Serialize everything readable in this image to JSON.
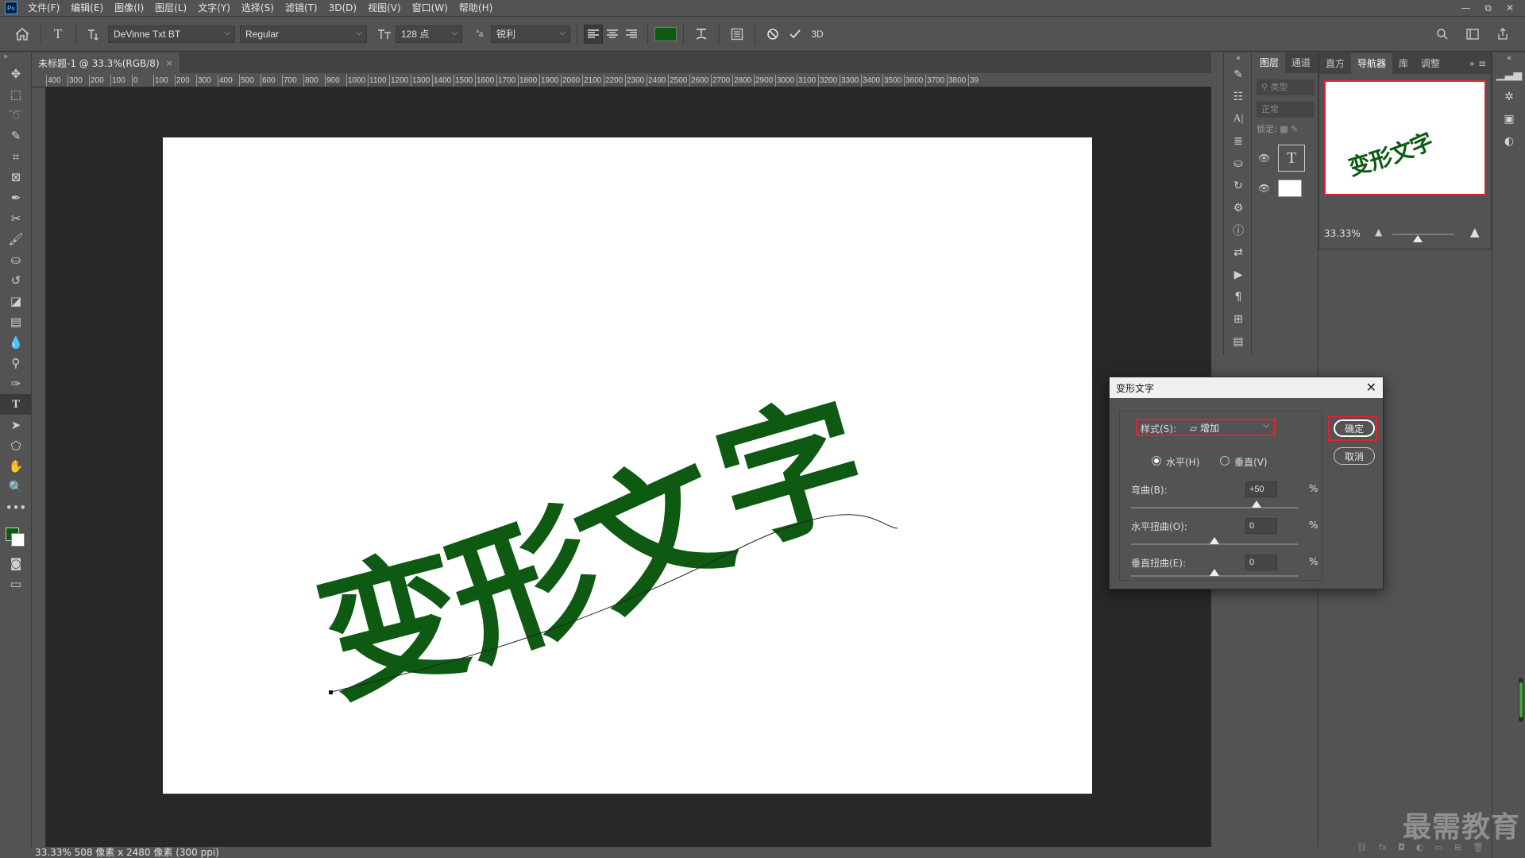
{
  "menubar": {
    "logo": "Ps",
    "items": [
      "文件(F)",
      "编辑(E)",
      "图像(I)",
      "图层(L)",
      "文字(Y)",
      "选择(S)",
      "滤镜(T)",
      "3D(D)",
      "视图(V)",
      "窗口(W)",
      "帮助(H)"
    ],
    "window_controls": [
      "—",
      "⧉",
      "✕"
    ]
  },
  "options": {
    "font_family": "DeVinne Txt BT",
    "font_style": "Regular",
    "font_size": "128 点",
    "antialias_icon_label": "ªa",
    "antialias": "锐利",
    "text_color": "#0e5a12",
    "three_d_label": "3D"
  },
  "document": {
    "tab_title": "未标题-1 @ 33.3%(RGB/8)",
    "tab_close": "×",
    "text": "变形文字",
    "text_color": "#0e5a12"
  },
  "ruler": {
    "h_labels": [
      "400",
      "300",
      "200",
      "100",
      "0",
      "100",
      "200",
      "300",
      "400",
      "500",
      "600",
      "700",
      "800",
      "900",
      "1000",
      "1100",
      "1200",
      "1300",
      "1400",
      "1500",
      "1600",
      "1700",
      "1800",
      "1900",
      "2000",
      "2100",
      "2200",
      "2300",
      "2400",
      "2500",
      "2600",
      "2700",
      "2800",
      "2900",
      "3000",
      "3100",
      "3200",
      "3300",
      "3400",
      "3500",
      "3600",
      "3700",
      "3800",
      "39"
    ]
  },
  "statusbar": {
    "text": "33.33%  508 像素 x 2480 像素 (300 ppi)"
  },
  "layers_panel": {
    "tabs": [
      "图层",
      "通道"
    ],
    "search_placeholder": "类型",
    "blend_mode": "正常",
    "lock_label": "锁定:"
  },
  "navigator_panel": {
    "tabs": [
      "直方",
      "导航器",
      "库",
      "调整"
    ],
    "active_tab": "导航器",
    "zoom": "33.33%",
    "preview_text": "变形文字"
  },
  "dialog": {
    "title": "变形文字",
    "close": "✕",
    "style_label": "样式(S):",
    "style_value": "增加",
    "horizontal_label": "水平(H)",
    "vertical_label": "垂直(V)",
    "orientation": "水平(H)",
    "bend_label": "弯曲(B):",
    "bend_value": "+50",
    "bend_level": 0.75,
    "h_distort_label": "水平扭曲(O):",
    "h_distort_value": "0",
    "h_distort_level": 0.5,
    "v_distort_label": "垂直扭曲(E):",
    "v_distort_value": "0",
    "v_distort_level": 0.5,
    "percent": "%",
    "ok_label": "确定",
    "cancel_label": "取消",
    "highlight_color": "#e0242e"
  },
  "watermark": "最需教育"
}
